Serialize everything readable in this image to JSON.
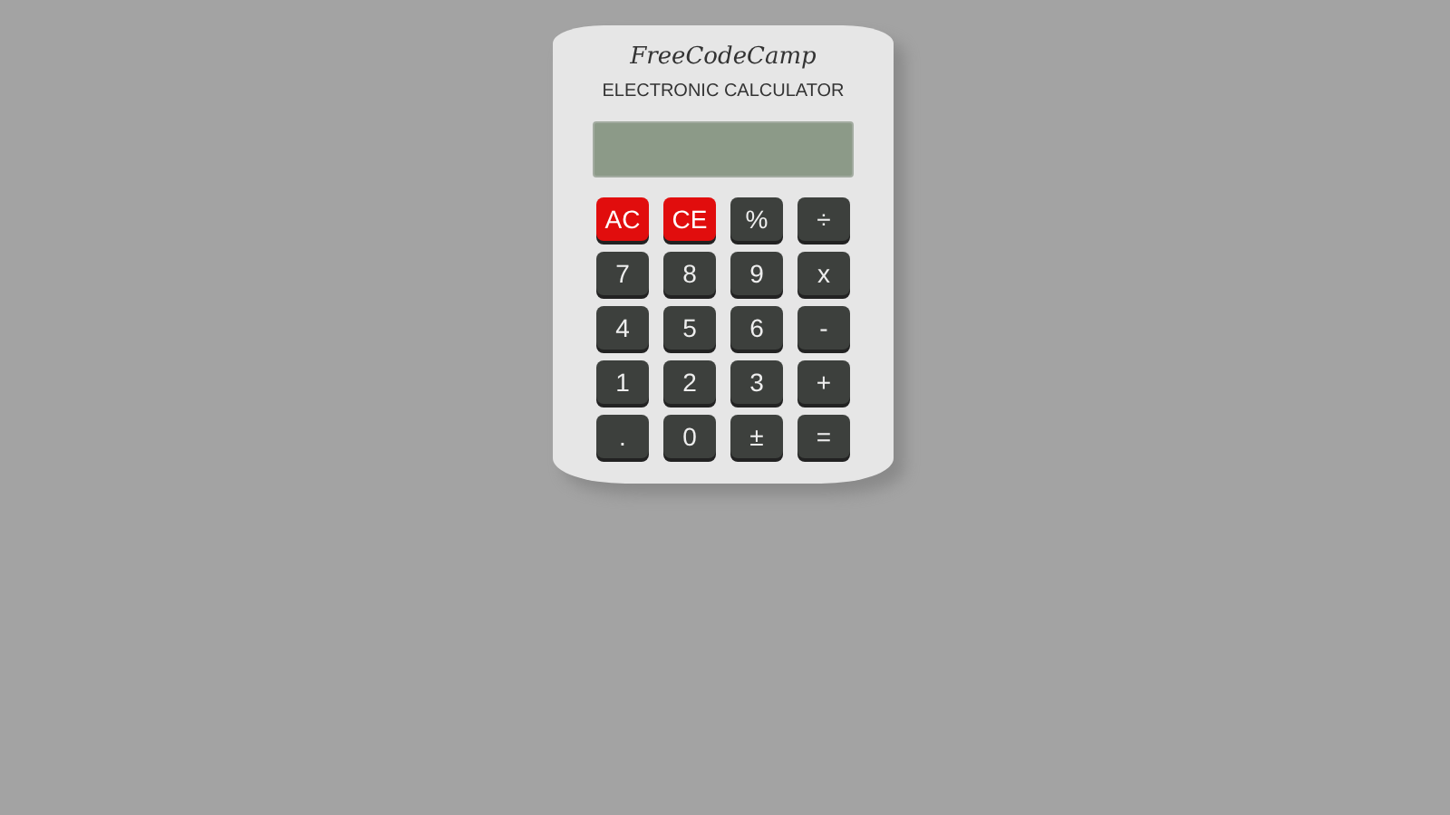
{
  "calculator": {
    "brand": "FreeCodeCamp",
    "model": "ELECTRONIC CALCULATOR",
    "keys": [
      {
        "label": "AC",
        "kind": "clear"
      },
      {
        "label": "CE",
        "kind": "clear"
      },
      {
        "label": "%",
        "kind": "normal"
      },
      {
        "label": "÷",
        "kind": "normal"
      },
      {
        "label": "7",
        "kind": "normal"
      },
      {
        "label": "8",
        "kind": "normal"
      },
      {
        "label": "9",
        "kind": "normal"
      },
      {
        "label": "x",
        "kind": "normal"
      },
      {
        "label": "4",
        "kind": "normal"
      },
      {
        "label": "5",
        "kind": "normal"
      },
      {
        "label": "6",
        "kind": "normal"
      },
      {
        "label": "-",
        "kind": "normal"
      },
      {
        "label": "1",
        "kind": "normal"
      },
      {
        "label": "2",
        "kind": "normal"
      },
      {
        "label": "3",
        "kind": "normal"
      },
      {
        "label": "+",
        "kind": "normal"
      },
      {
        "label": ".",
        "kind": "normal"
      },
      {
        "label": "0",
        "kind": "normal"
      },
      {
        "label": "±",
        "kind": "normal"
      },
      {
        "label": "=",
        "kind": "normal"
      }
    ]
  }
}
